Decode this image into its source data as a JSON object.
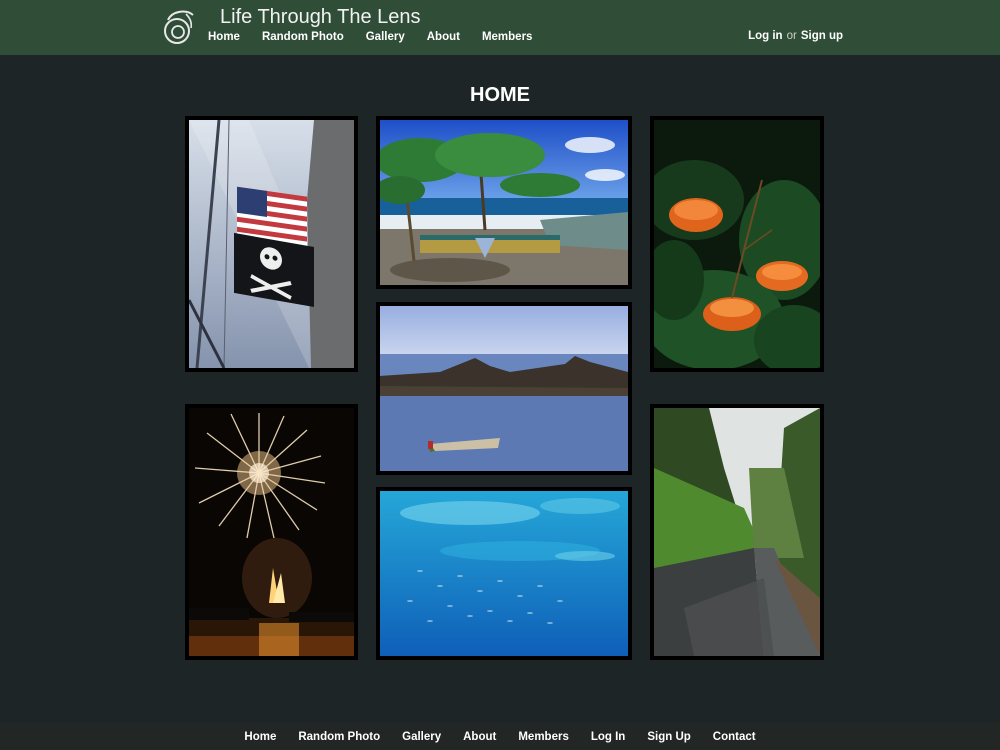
{
  "site": {
    "title": "Life Through The Lens"
  },
  "nav": {
    "items": [
      "Home",
      "Random Photo",
      "Gallery",
      "About",
      "Members"
    ]
  },
  "auth": {
    "login": "Log in",
    "or": "or",
    "signup": "Sign up"
  },
  "page": {
    "heading": "HOME"
  },
  "footer": {
    "items": [
      "Home",
      "Random Photo",
      "Gallery",
      "About",
      "Members",
      "Log In",
      "Sign Up",
      "Contact"
    ]
  },
  "colors": {
    "header_bg": "#2f4d37",
    "page_bg": "#1d2526",
    "footer_bg": "#222625"
  }
}
